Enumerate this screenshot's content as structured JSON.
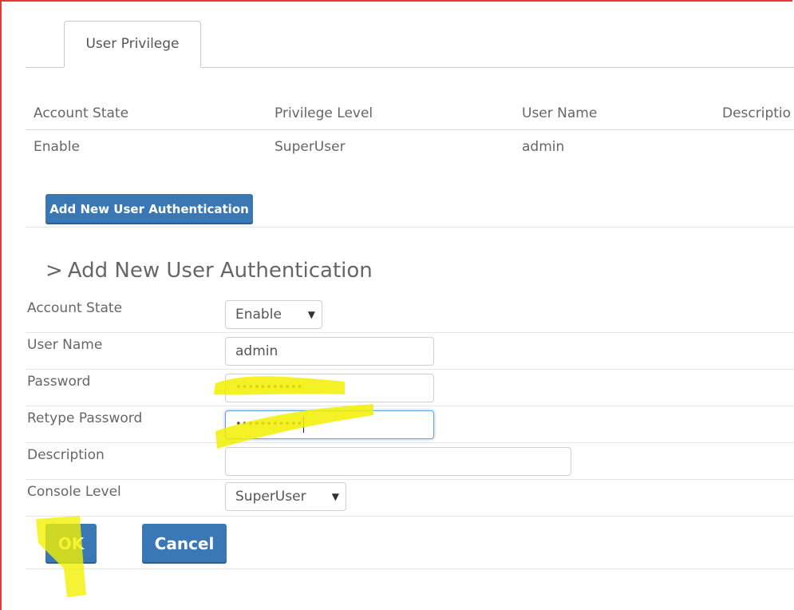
{
  "tabs": [
    {
      "label": "User Privilege"
    }
  ],
  "table": {
    "headers": [
      "Account State",
      "Privilege Level",
      "User Name",
      "Descriptio"
    ],
    "rows": [
      [
        "Enable",
        "SuperUser",
        "admin",
        ""
      ]
    ]
  },
  "add_button_label": "Add New User Authentication",
  "section": {
    "chevron": ">",
    "title": "Add New User Authentication"
  },
  "form": {
    "account_state": {
      "label": "Account State",
      "value": "Enable",
      "arrow": "▼"
    },
    "user_name": {
      "label": "User Name",
      "value": "admin"
    },
    "password": {
      "label": "Password",
      "value": "•••••••••••"
    },
    "retype_password": {
      "label": "Retype Password",
      "value": "•••••••••••"
    },
    "description": {
      "label": "Description",
      "value": ""
    },
    "console_level": {
      "label": "Console Level",
      "value": "SuperUser",
      "arrow": "▼"
    }
  },
  "buttons": {
    "ok": "OK",
    "cancel": "Cancel"
  },
  "colors": {
    "accent": "#3a78b5",
    "highlight": "#f2f000",
    "frame": "#e53935"
  }
}
